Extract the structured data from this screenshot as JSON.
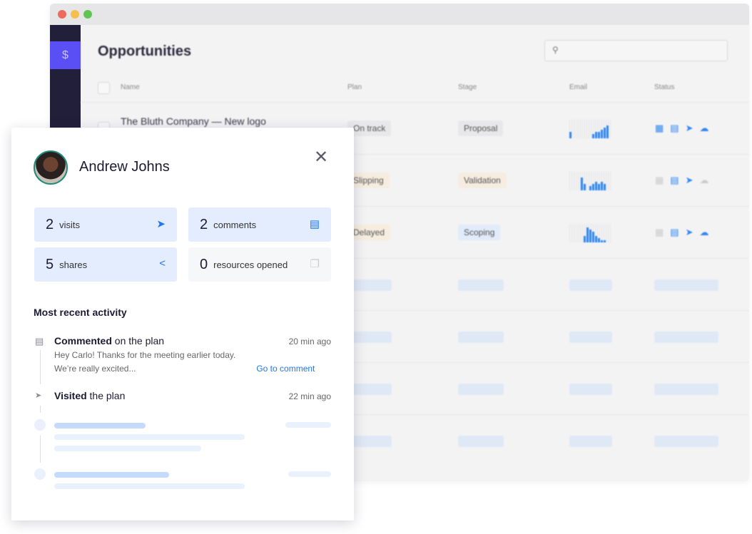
{
  "app": {
    "title": "Opportunities",
    "search_placeholder": "",
    "search_icon": "search-icon",
    "sidebar_active_icon": "dollar-icon",
    "columns": [
      "Name",
      "Plan",
      "Stage",
      "Email",
      "Status"
    ],
    "rows": [
      {
        "name": "The Bluth Company — New logo",
        "plan": "On track",
        "stage": "Proposal",
        "plan_color": "#e8e8ea",
        "stage_color": "#e8e8ea",
        "status_icons": [
          "calendar-icon",
          "building-icon",
          "send-icon",
          "cloud-icon"
        ],
        "status_active": [
          true,
          true,
          true,
          true
        ],
        "email_bars": [
          3,
          0,
          0,
          0,
          0,
          0,
          0,
          0,
          2,
          3,
          3,
          4,
          5,
          6
        ]
      },
      {
        "name": "",
        "plan": "Slipping",
        "stage": "Validation",
        "plan_color": "#f6ecdf",
        "stage_color": "#f6ecdf",
        "status_icons": [
          "calendar-icon",
          "building-icon",
          "send-icon",
          "cloud-icon"
        ],
        "status_active": [
          false,
          true,
          true,
          false
        ],
        "email_bars": [
          0,
          0,
          0,
          0,
          6,
          3,
          0,
          2,
          3,
          4,
          3,
          4,
          3,
          0
        ]
      },
      {
        "name": "",
        "plan": "Delayed",
        "stage": "Scoping",
        "plan_color": "#f6ecdf",
        "stage_color": "#e1ebfa",
        "status_icons": [
          "calendar-icon",
          "building-icon",
          "send-icon",
          "cloud-icon"
        ],
        "status_active": [
          false,
          true,
          true,
          true
        ],
        "email_bars": [
          0,
          0,
          0,
          0,
          0,
          3,
          7,
          6,
          5,
          3,
          2,
          1,
          1,
          0
        ]
      }
    ]
  },
  "panel": {
    "user_name": "Andrew Johns",
    "close_icon": "close-icon",
    "stats": [
      {
        "count": "2",
        "label": "visits",
        "icon": "cursor-icon"
      },
      {
        "count": "2",
        "label": "comments",
        "icon": "comment-icon"
      },
      {
        "count": "5",
        "label": "shares",
        "icon": "share-icon"
      },
      {
        "count": "0",
        "label": "resources opened",
        "icon": "document-icon"
      }
    ],
    "activity_title": "Most recent activity",
    "activities": [
      {
        "action": "Commented",
        "rest": " on the plan",
        "time": "20 min ago",
        "message": "Hey Carlo! Thanks for the meeting earlier today. We’re really excited...",
        "link": "Go to comment"
      },
      {
        "action": "Visited",
        "rest": " the plan",
        "time": "22 min ago"
      }
    ]
  },
  "colors": {
    "accent": "#1e77f0",
    "sidebar": "#211f3a",
    "sidebar_active": "#5a4ff5"
  }
}
